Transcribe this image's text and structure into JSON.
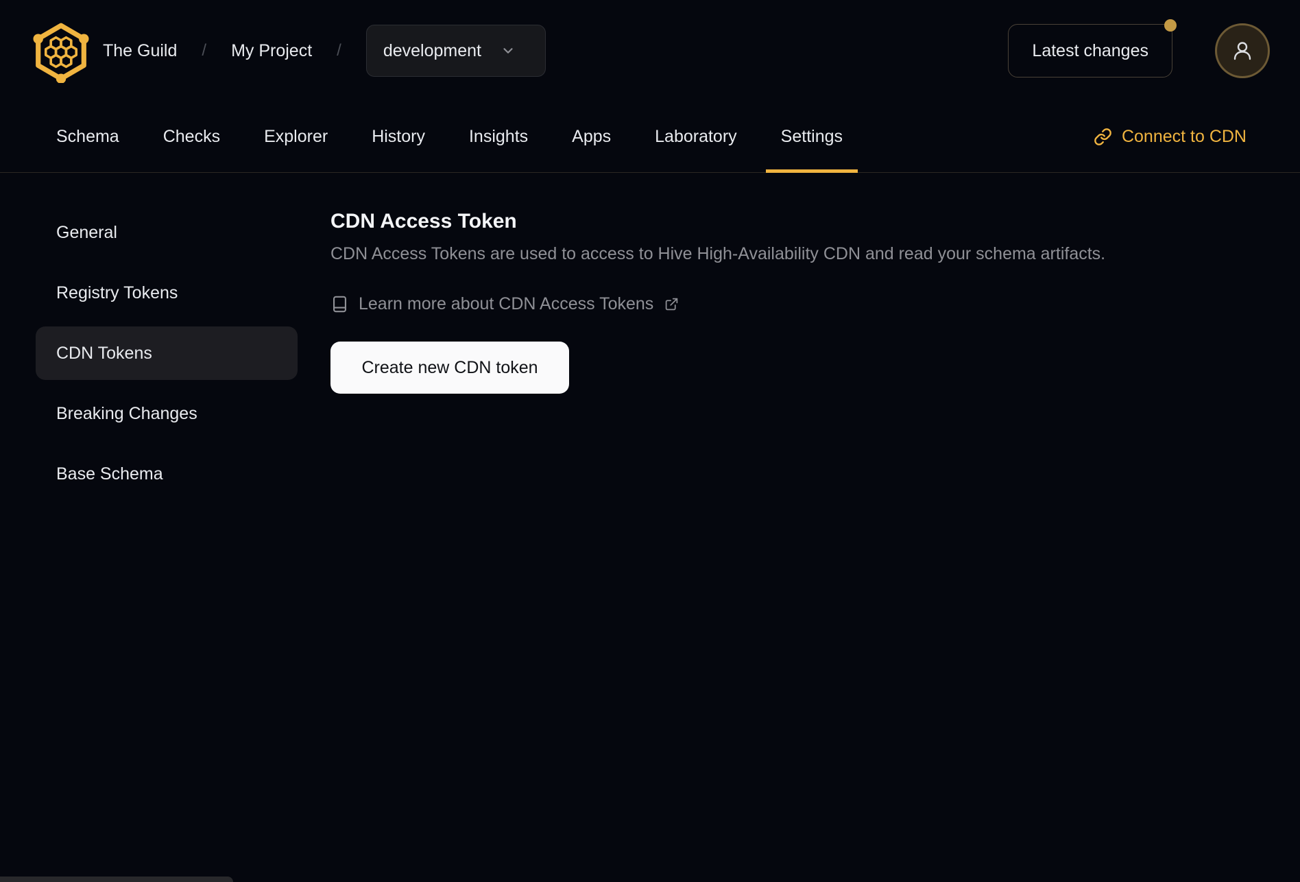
{
  "header": {
    "org": "The Guild",
    "separator": "/",
    "project": "My Project",
    "target_select": {
      "value": "development"
    },
    "latest_changes_label": "Latest changes",
    "notification_dot": true
  },
  "tabs": {
    "items": [
      {
        "label": "Schema"
      },
      {
        "label": "Checks"
      },
      {
        "label": "Explorer"
      },
      {
        "label": "History"
      },
      {
        "label": "Insights"
      },
      {
        "label": "Apps"
      },
      {
        "label": "Laboratory"
      },
      {
        "label": "Settings"
      }
    ],
    "active": "Settings",
    "connect_cdn_label": "Connect to CDN"
  },
  "sidebar": {
    "items": [
      {
        "label": "General"
      },
      {
        "label": "Registry Tokens"
      },
      {
        "label": "CDN Tokens"
      },
      {
        "label": "Breaking Changes"
      },
      {
        "label": "Base Schema"
      }
    ],
    "active": "CDN Tokens"
  },
  "main": {
    "title": "CDN Access Token",
    "description": "CDN Access Tokens are used to access to Hive High-Availability CDN and read your schema artifacts.",
    "learn_more_label": "Learn more about CDN Access Tokens",
    "create_button_label": "Create new CDN token"
  },
  "icons": {
    "logo": "hive-honeycomb-logo-icon",
    "select_chevron": "chevron-down-icon",
    "avatar": "user-icon",
    "connect": "link-chain-icon",
    "learn_more_leading": "book-icon",
    "learn_more_trailing": "external-link-icon"
  },
  "colors": {
    "bg": "#05070e",
    "panel": "#17181c",
    "panel_border": "#2b2d33",
    "warm_border": "#4a4238",
    "accent": "#f0b440",
    "gold_dot": "#c49a45",
    "avatar_ring": "#6d5a35",
    "avatar_bg": "#292217",
    "text": "#e9ebef",
    "text_muted": "#8f9096",
    "sep": "#4b4e56",
    "sidebar_active": "#1d1d22",
    "tab_border": "#2b2823",
    "button_bg": "#fafafb",
    "button_text": "#101216",
    "toast": "#28282b"
  }
}
